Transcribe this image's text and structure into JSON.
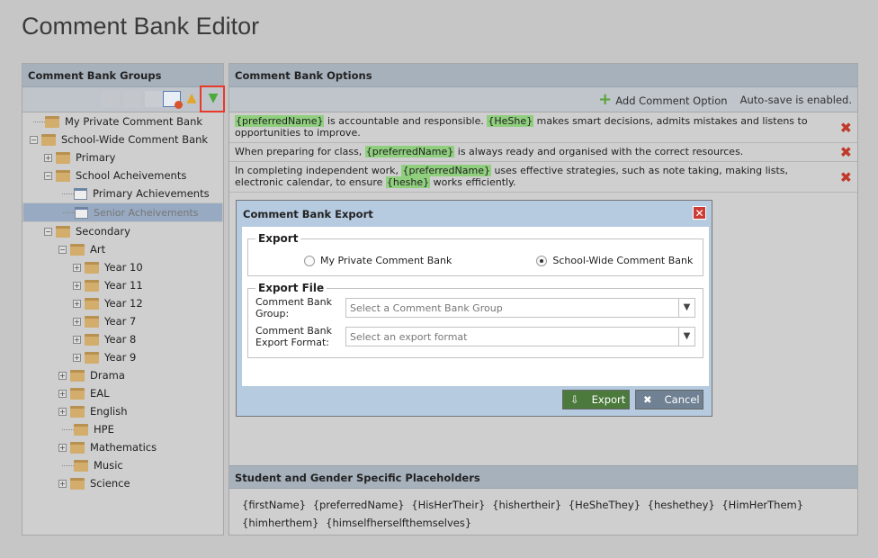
{
  "page_title": "Comment Bank Editor",
  "left": {
    "title": "Comment Bank Groups",
    "tree": [
      {
        "label": "My Private Comment Bank",
        "level": 0,
        "toggle": "",
        "icon": "folder"
      },
      {
        "label": "School-Wide Comment Bank",
        "level": 0,
        "toggle": "−",
        "icon": "folder"
      },
      {
        "label": "Primary",
        "level": 1,
        "toggle": "+",
        "icon": "folder"
      },
      {
        "label": "School Acheivements",
        "level": 1,
        "toggle": "−",
        "icon": "folder"
      },
      {
        "label": "Primary Achievements",
        "level": 2,
        "toggle": "",
        "icon": "doc"
      },
      {
        "label": "Senior Acheivements",
        "level": 2,
        "toggle": "",
        "icon": "doc",
        "selected": true
      },
      {
        "label": "Secondary",
        "level": 1,
        "toggle": "−",
        "icon": "folder"
      },
      {
        "label": "Art",
        "level": 2,
        "toggle": "−",
        "icon": "folder"
      },
      {
        "label": "Year 10",
        "level": 3,
        "toggle": "+",
        "icon": "folder"
      },
      {
        "label": "Year 11",
        "level": 3,
        "toggle": "+",
        "icon": "folder"
      },
      {
        "label": "Year 12",
        "level": 3,
        "toggle": "+",
        "icon": "folder"
      },
      {
        "label": "Year 7",
        "level": 3,
        "toggle": "+",
        "icon": "folder"
      },
      {
        "label": "Year 8",
        "level": 3,
        "toggle": "+",
        "icon": "folder"
      },
      {
        "label": "Year 9",
        "level": 3,
        "toggle": "+",
        "icon": "folder"
      },
      {
        "label": "Drama",
        "level": 2,
        "toggle": "+",
        "icon": "folder"
      },
      {
        "label": "EAL",
        "level": 2,
        "toggle": "+",
        "icon": "folder"
      },
      {
        "label": "English",
        "level": 2,
        "toggle": "+",
        "icon": "folder"
      },
      {
        "label": "HPE",
        "level": 2,
        "toggle": "",
        "icon": "folder"
      },
      {
        "label": "Mathematics",
        "level": 2,
        "toggle": "+",
        "icon": "folder"
      },
      {
        "label": "Music",
        "level": 2,
        "toggle": "",
        "icon": "folder"
      },
      {
        "label": "Science",
        "level": 2,
        "toggle": "+",
        "icon": "folder"
      }
    ]
  },
  "right": {
    "title": "Comment Bank Options",
    "add_label": "Add Comment Option",
    "autosave": "Auto-save is enabled.",
    "comments": [
      [
        {
          "t": "{preferredName}",
          "ph": true
        },
        {
          "t": " is accountable and responsible. "
        },
        {
          "t": "{HeShe}",
          "ph": true
        },
        {
          "t": " makes smart decisions, admits mistakes and listens to opportunities to improve."
        }
      ],
      [
        {
          "t": "When preparing for class, "
        },
        {
          "t": "{preferredName}",
          "ph": true
        },
        {
          "t": " is always ready and organised with the correct resources."
        }
      ],
      [
        {
          "t": "In completing independent work, "
        },
        {
          "t": "{preferredName}",
          "ph": true
        },
        {
          "t": " uses effective strategies, such as note taking, making lists, electronic calendar, to ensure "
        },
        {
          "t": "{heshe}",
          "ph": true
        },
        {
          "t": " works efficiently."
        }
      ]
    ],
    "placeholders_title": "Student and Gender Specific Placeholders",
    "placeholders": "{firstName} {preferredName} {HisHerTheir} {hishertheir} {HeSheThey} {heshethey} {HimHerThem} {himherthem} {himselfherselfthemselves}"
  },
  "dialog": {
    "title": "Comment Bank Export",
    "export_legend": "Export",
    "radio_private": "My Private Comment Bank",
    "radio_school": "School-Wide Comment Bank",
    "file_legend": "Export File",
    "group_label": "Comment Bank Group:",
    "group_placeholder": "Select a Comment Bank Group",
    "format_label": "Comment Bank Export Format:",
    "format_placeholder": "Select an export format",
    "export_btn": "Export",
    "cancel_btn": "Cancel"
  }
}
